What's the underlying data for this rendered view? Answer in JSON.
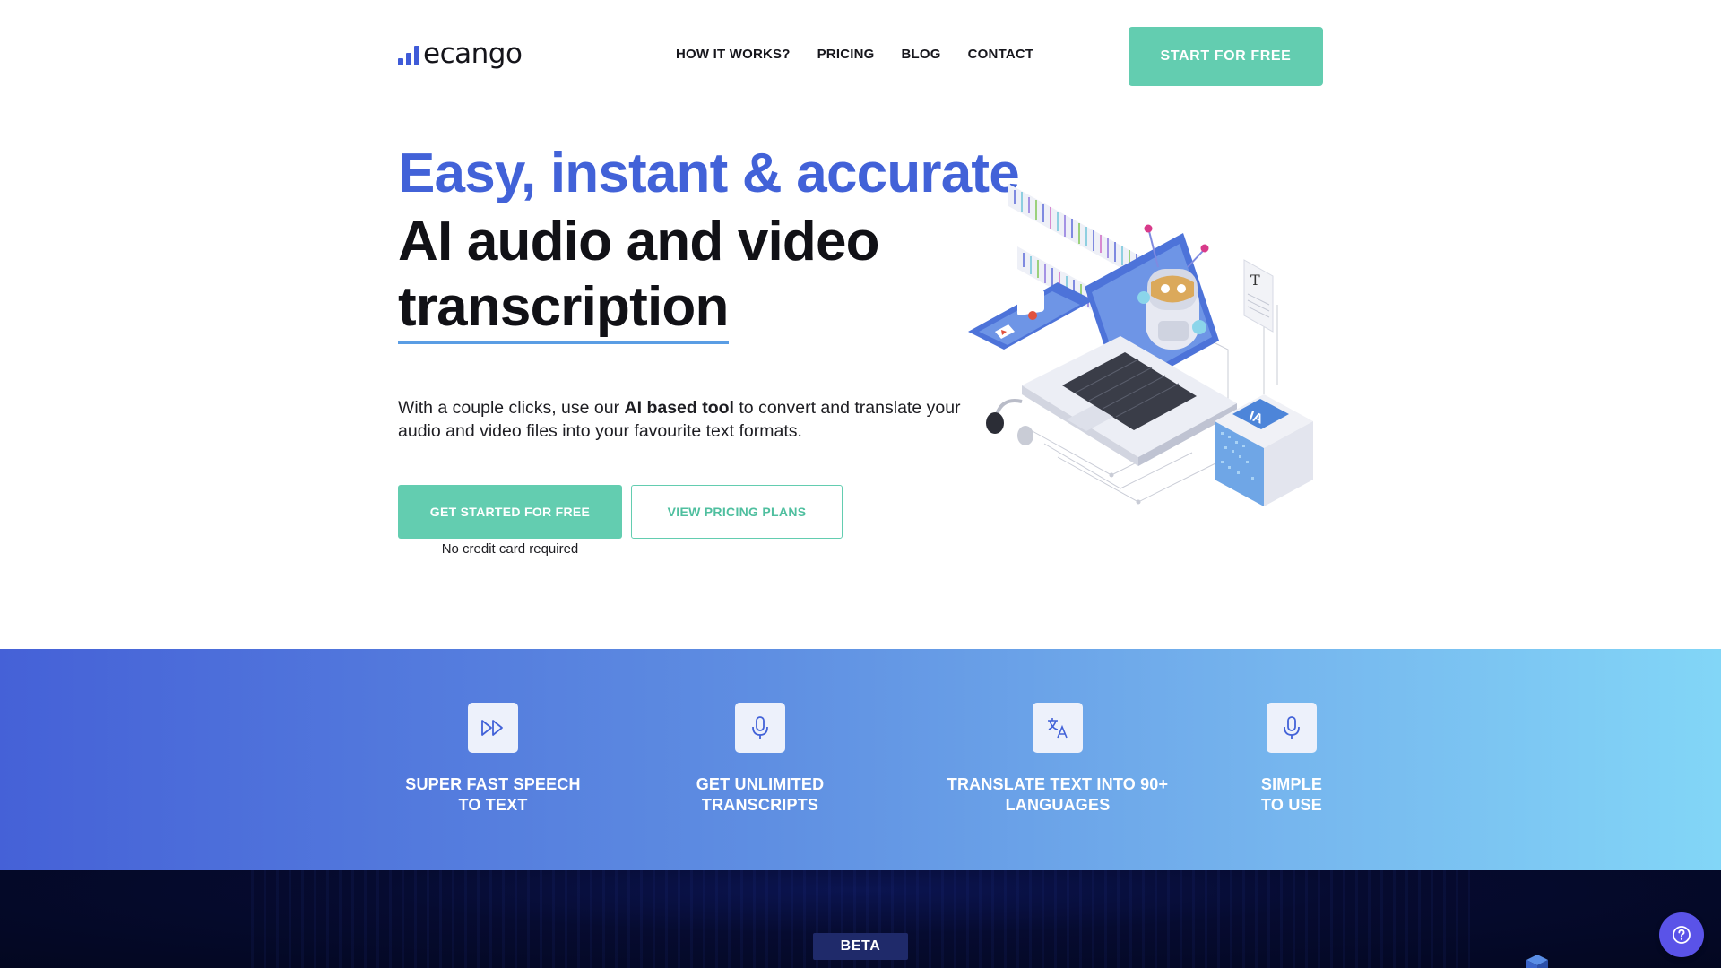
{
  "brand": {
    "name": "ecango",
    "color": "#3f5bd8"
  },
  "nav": {
    "items": [
      {
        "label": "HOW IT WORKS?"
      },
      {
        "label": "PRICING"
      },
      {
        "label": "BLOG"
      },
      {
        "label": "CONTACT"
      }
    ],
    "cta_label": "START FOR FREE"
  },
  "hero": {
    "title_line1": "Easy, instant & accurate",
    "title_line2": "AI audio and video",
    "title_line3": "transcription",
    "desc_before": "With a couple clicks, use our ",
    "desc_bold": "AI based tool",
    "desc_after": " to convert and translate your audio and video files into your favourite text formats.",
    "primary_cta": "GET STARTED FOR FREE",
    "secondary_cta": "VIEW PRICING PLANS",
    "note": "No credit card required",
    "illustration_icon": "ai-transcription-illustration",
    "illustration_badge": "IA"
  },
  "features": [
    {
      "icon": "fast-forward-icon",
      "line1": "SUPER FAST SPEECH",
      "line2": "TO TEXT"
    },
    {
      "icon": "microphone-icon",
      "line1": "GET UNLIMITED",
      "line2": "TRANSCRIPTS"
    },
    {
      "icon": "translate-icon",
      "line1": "TRANSLATE TEXT INTO 90+",
      "line2": "LANGUAGES"
    },
    {
      "icon": "microphone-icon",
      "line1": "SIMPLE",
      "line2": "TO USE"
    }
  ],
  "colors": {
    "accent_green": "#63cdb0",
    "title_blue": "#4262d8",
    "band_start": "#4561d7",
    "band_end": "#82d6f7",
    "dark_bg": "#060b30",
    "help_button": "#5a53e8"
  },
  "beta_label": "BETA",
  "help_icon": "help-question-icon"
}
